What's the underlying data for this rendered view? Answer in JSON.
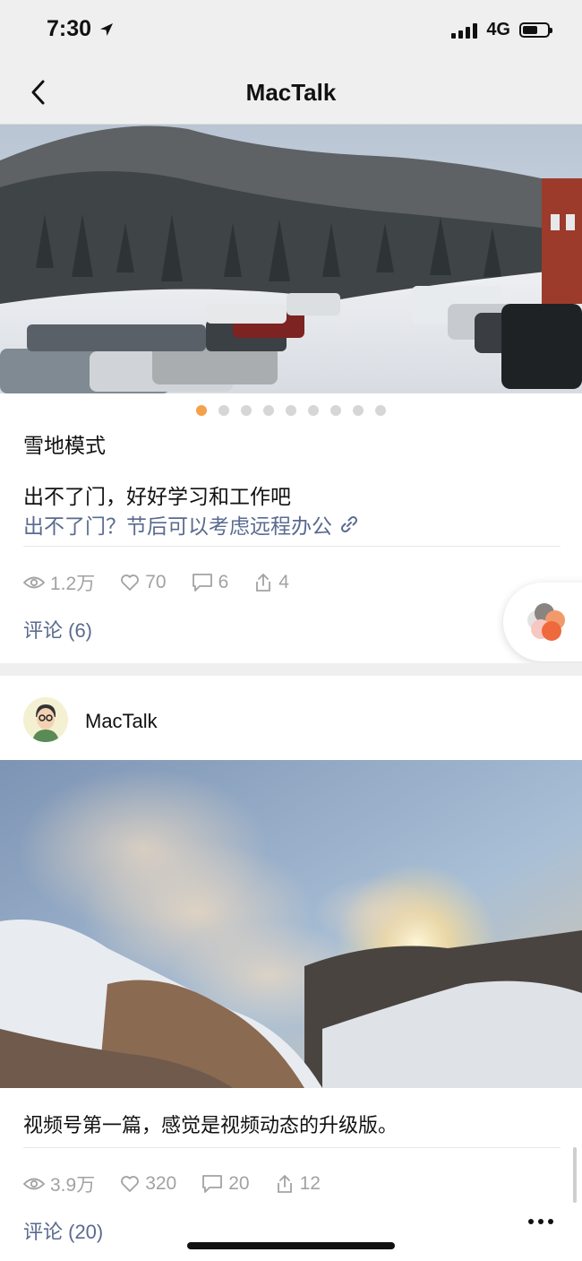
{
  "status_bar": {
    "time": "7:30",
    "network": "4G"
  },
  "nav": {
    "title": "MacTalk",
    "back_icon": "chevron-left-icon"
  },
  "post1": {
    "image": "snowy-parking-lot-photo",
    "carousel": {
      "count": 9,
      "active_index": 0,
      "active_color": "#f5a14b",
      "inactive_color": "#d6d6d6"
    },
    "title": "雪地模式",
    "text": "出不了门，好好学习和工作吧",
    "link": "出不了门？节后可以考虑远程办公",
    "stats": {
      "views": "1.2万",
      "likes": "70",
      "comments": "6",
      "shares": "4"
    },
    "comments_label": "评论 (6)"
  },
  "post2": {
    "author": "MacTalk",
    "image": "volcanic-steam-sunset-photo",
    "text": "视频号第一篇，感觉是视频动态的升级版。",
    "stats": {
      "views": "3.9万",
      "likes": "320",
      "comments": "20",
      "shares": "12"
    },
    "comments_label": "评论 (20)"
  },
  "colors": {
    "link": "#5a6b8f",
    "stat_gray": "#a2a2a2",
    "bar_bg": "#efefef"
  }
}
